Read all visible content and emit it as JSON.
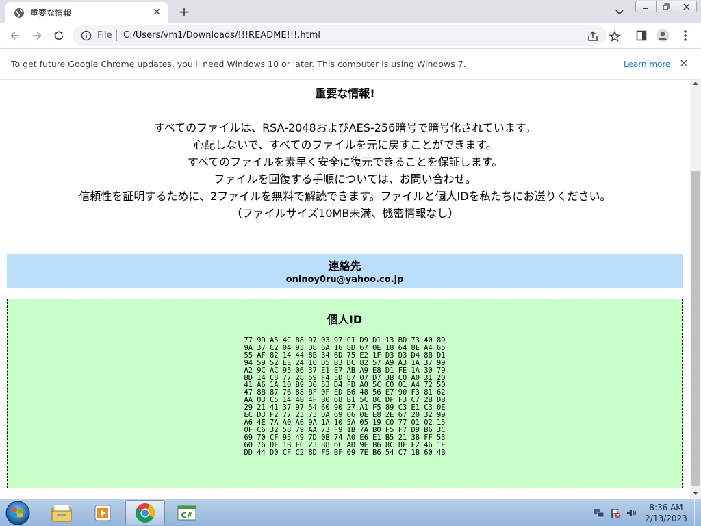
{
  "browser": {
    "tab": {
      "title": "重要な情報",
      "favicon": "globe-icon",
      "close_icon": "close-icon"
    },
    "new_tab_icon": "plus-icon",
    "tab_search_icon": "chevron-down-icon",
    "window_controls": [
      "minimize-icon",
      "restore-icon",
      "close-icon"
    ],
    "toolbar": {
      "back_icon": "back-arrow-icon",
      "forward_icon": "forward-arrow-icon",
      "reload_icon": "reload-icon",
      "site_info_icon": "info-icon",
      "file_chip": "File",
      "url": "C:/Users/vm1/Downloads/!!!README!!!.html",
      "share_icon": "share-icon",
      "bookmark_icon": "star-icon",
      "side_panel_icon": "side-panel-icon",
      "profile_icon": "profile-icon",
      "menu_icon": "kebab-menu-icon"
    },
    "infobar": {
      "message": "To get future Google Chrome updates, you'll need Windows 10 or later. This computer is using Windows 7.",
      "link": "Learn more",
      "close_icon": "close-icon"
    }
  },
  "page": {
    "heading": "重要な情報!",
    "lines": [
      "すべてのファイルは、RSA-2048およびAES-256暗号で暗号化されています。",
      "心配しないで、すべてのファイルを元に戻すことができます。",
      "すべてのファイルを素早く安全に復元できることを保証します。",
      "ファイルを回復する手順については、お問い合わせ。",
      "信頼性を証明するために、2ファイルを無料で解読できます。ファイルと個人IDを私たちにお送りください。",
      "（ファイルサイズ10MB未満、機密情報なし）"
    ],
    "contact": {
      "title": "連絡先",
      "email": "oninoy0ru@yahoo.co.jp"
    },
    "personal_id": {
      "title": "個人ID",
      "hex_lines": [
        "77 9D A5 4C B8 97 03 97 C1 D9 D1 13 BD 73 40 89",
        "9A 37 C2 04 93 D8 6A 16 8D 67 0E 18 64 8E A4 65",
        "55 AF 82 14 44 8B 34 6D 75 E2 1F D3 D3 D4 8B D1",
        "94 59 52 EE 24 10 D5 B3 DC 82 57 A9 A3 1A 37 99",
        "A2 9C AC 95 06 37 E1 E7 AB A9 E8 D1 FE 1A 30 79",
        "BD 14 C8 77 28 59 F4 5D 87 07 D7 3B C0 A0 31 20",
        "41 A6 1A 10 B9 30 53 D4 FD A0 5C C0 01 A4 72 50",
        "47 8B 87 76 88 BF 0F ED B6 48 56 E7 90 F3 81 62",
        "AA 03 C5 14 4B 4F B0 68 B1 5C 8C DF F3 C7 2B DB",
        "29 21 41 37 97 54 60 90 27 A1 F5 89 C3 E1 C3 0E",
        "EC D3 F2 77 23 73 DA 69 06 0E E8 2E 67 20 32 99",
        "A6 4E 7A A0 A6 9A 1A 10 5A 05 19 C0 77 01 02 15",
        "0F C6 32 58 79 AA 73 F9 1B 7A B0 F5 F7 D9 B6 3C",
        "69 70 CF 95 49 7D 0B 74 A0 E6 E1 B5 21 38 FF 53",
        "60 76 0F 1B FC 23 88 6C AD 9E B6 8C 8F F2 46 1E",
        "DD 44 D0 CF C2 8D F5 BF 09 7E B6 54 C7 1B 60 4B"
      ]
    }
  },
  "taskbar": {
    "start_icon": "windows-start-icon",
    "apps": [
      {
        "name": "explorer-icon",
        "state": "pinned"
      },
      {
        "name": "media-player-icon",
        "state": "pinned"
      },
      {
        "name": "chrome-icon",
        "state": "active"
      },
      {
        "name": "csharp-app-icon",
        "state": "pinned"
      }
    ],
    "tray_icons": [
      "network-icon",
      "action-center-flag-icon",
      "volume-icon"
    ],
    "clock": {
      "time": "8:36 AM",
      "date": "2/13/2023"
    }
  },
  "colors": {
    "contact_bg": "#bbdefb",
    "id_bg": "#c8ffc8",
    "link": "#1a73e8",
    "tabstrip": "#dee1e6"
  }
}
